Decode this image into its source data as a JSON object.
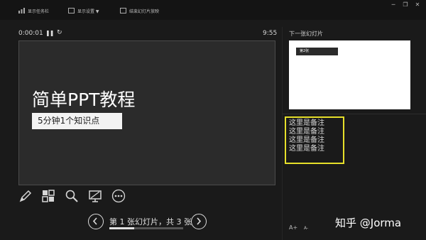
{
  "toolbar": {
    "show_taskbar": "显示任务栏",
    "display_settings": "显示设置 ▼",
    "end_slideshow": "结束幻灯片放映"
  },
  "timer": {
    "elapsed": "0:00:01",
    "pause_symbol": "❚❚",
    "reset_symbol": "↻",
    "clock": "9:55"
  },
  "slide": {
    "title": "简单PPT教程",
    "subtitle": "5分钟1个知识点"
  },
  "tools": [
    "pen-icon",
    "all-slides-icon",
    "zoom-icon",
    "screen-icon",
    "more-options-icon"
  ],
  "navigation": {
    "label": "第 1 张幻灯片，共 3 张",
    "progress": 0.333
  },
  "next_slide": {
    "label": "下一张幻灯片",
    "tag": "第2张"
  },
  "notes": {
    "lines": [
      "这里是备注",
      "这里是备注",
      "这里是备注",
      "这里是备注"
    ]
  },
  "font_controls": {
    "increase": "A+",
    "decrease": "A-"
  },
  "watermark": "知乎 @Jorma",
  "colors": {
    "background": "#1a1a1a",
    "notes_highlight": "#e6df2a"
  }
}
